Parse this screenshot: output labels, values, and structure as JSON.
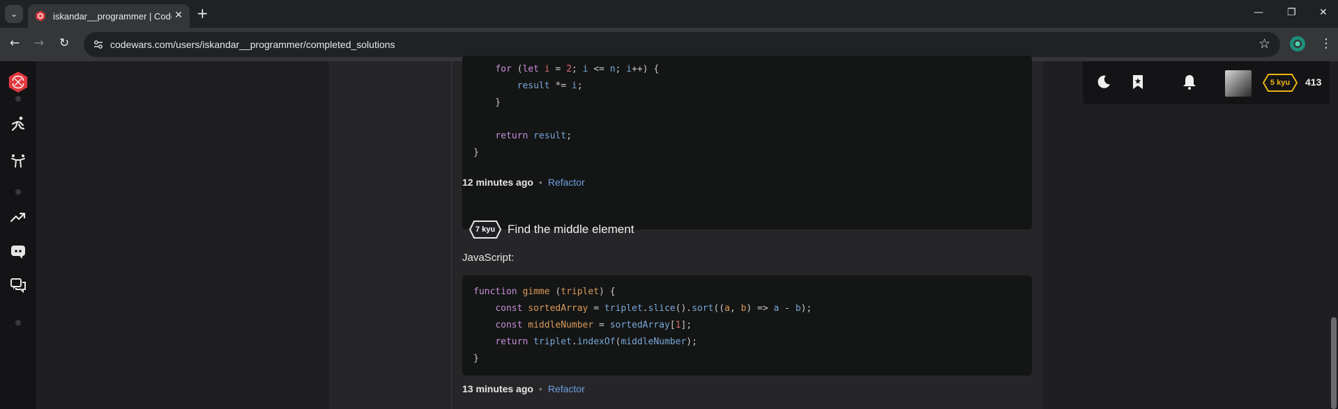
{
  "browser": {
    "tab_list_icon": "chevron-down-icon",
    "tab_title": "iskandar__programmer | Codewars",
    "new_tab_label": "+",
    "url": "codewars.com/users/iskandar__programmer/completed_solutions",
    "window_controls": {
      "minimize": "—",
      "maximize": "❐",
      "close": "✕"
    },
    "tab_close": "✕",
    "nav": {
      "back": "←",
      "forward": "→",
      "reload": "↻"
    },
    "star": "☆",
    "menu": "⋮"
  },
  "sidebar": {
    "items": [
      {
        "icon": "codewars-logo-icon"
      },
      {
        "icon": "practice-icon"
      },
      {
        "icon": "kumite-icon"
      },
      {
        "icon": "leaderboard-icon"
      },
      {
        "icon": "discord-icon"
      },
      {
        "icon": "discussion-icon"
      }
    ]
  },
  "userbar": {
    "icons": [
      "moon-icon",
      "bookmark-icon",
      "bell-icon"
    ],
    "rank": "5 kyu",
    "honor": "413"
  },
  "solution_1": {
    "code_lines": [
      [
        {
          "t": "    "
        },
        {
          "t": "for",
          "c": "kw"
        },
        {
          "t": " ("
        },
        {
          "t": "let",
          "c": "kw"
        },
        {
          "t": " "
        },
        {
          "t": "i",
          "c": "num"
        },
        {
          "t": " = "
        },
        {
          "t": "2",
          "c": "num"
        },
        {
          "t": "; "
        },
        {
          "t": "i",
          "c": "var"
        },
        {
          "t": " <= "
        },
        {
          "t": "n",
          "c": "var"
        },
        {
          "t": "; "
        },
        {
          "t": "i",
          "c": "var"
        },
        {
          "t": "++) {"
        }
      ],
      [
        {
          "t": "        "
        },
        {
          "t": "result",
          "c": "var"
        },
        {
          "t": " *= "
        },
        {
          "t": "i",
          "c": "var"
        },
        {
          "t": ";"
        }
      ],
      [
        {
          "t": "    }"
        }
      ],
      [
        {
          "t": ""
        }
      ],
      [
        {
          "t": "    "
        },
        {
          "t": "return",
          "c": "kw"
        },
        {
          "t": " "
        },
        {
          "t": "result",
          "c": "var"
        },
        {
          "t": ";"
        }
      ],
      [
        {
          "t": "}"
        }
      ]
    ],
    "time": "12 minutes ago",
    "separator": "•",
    "refactor": "Refactor"
  },
  "solution_2": {
    "kyu": "7 kyu",
    "title": "Find the middle element",
    "language": "JavaScript:",
    "code_lines": [
      [
        {
          "t": "function",
          "c": "kw"
        },
        {
          "t": " "
        },
        {
          "t": "gimme",
          "c": "fn"
        },
        {
          "t": " ("
        },
        {
          "t": "triplet",
          "c": "fn"
        },
        {
          "t": ") {"
        }
      ],
      [
        {
          "t": "    "
        },
        {
          "t": "const",
          "c": "kw"
        },
        {
          "t": " "
        },
        {
          "t": "sortedArray",
          "c": "fn"
        },
        {
          "t": " = "
        },
        {
          "t": "triplet",
          "c": "var"
        },
        {
          "t": "."
        },
        {
          "t": "slice",
          "c": "var"
        },
        {
          "t": "()."
        },
        {
          "t": "sort",
          "c": "var"
        },
        {
          "t": "(("
        },
        {
          "t": "a",
          "c": "fn"
        },
        {
          "t": ", "
        },
        {
          "t": "b",
          "c": "fn"
        },
        {
          "t": ") => "
        },
        {
          "t": "a",
          "c": "var"
        },
        {
          "t": " - "
        },
        {
          "t": "b",
          "c": "var"
        },
        {
          "t": ");"
        }
      ],
      [
        {
          "t": "    "
        },
        {
          "t": "const",
          "c": "kw"
        },
        {
          "t": " "
        },
        {
          "t": "middleNumber",
          "c": "fn"
        },
        {
          "t": " = "
        },
        {
          "t": "sortedArray",
          "c": "var"
        },
        {
          "t": "["
        },
        {
          "t": "1",
          "c": "num"
        },
        {
          "t": "];"
        }
      ],
      [
        {
          "t": "    "
        },
        {
          "t": "return",
          "c": "kw"
        },
        {
          "t": " "
        },
        {
          "t": "triplet",
          "c": "var"
        },
        {
          "t": "."
        },
        {
          "t": "indexOf",
          "c": "var"
        },
        {
          "t": "("
        },
        {
          "t": "middleNumber",
          "c": "var"
        },
        {
          "t": ");"
        }
      ],
      [
        {
          "t": "}"
        }
      ]
    ],
    "time": "13 minutes ago",
    "separator": "•",
    "refactor": "Refactor"
  },
  "colors": {
    "codewars_red": "#e0393e",
    "rank_yellow": "#ecb613",
    "link_blue": "#6f9fe0"
  }
}
